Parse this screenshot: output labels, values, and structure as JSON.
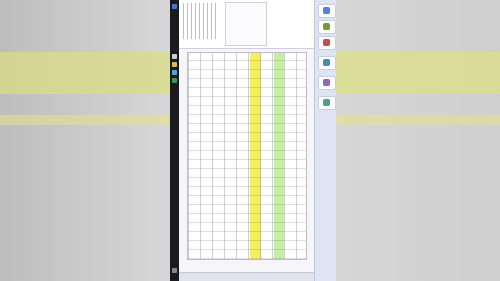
{
  "overlay": {
    "caption": ""
  },
  "colors": {
    "highlight_green": "#c6eea0",
    "highlight_yellow": "#f3f05a",
    "overlay_red": "#e81a1a",
    "ribbon_bg": "#dfe4f2",
    "taskbar": "#1b1b1f"
  },
  "taskbar": {
    "icons": [
      "start-icon",
      "search-icon",
      "folder-icon",
      "browser-icon",
      "app-icon"
    ]
  },
  "ribbon": {
    "buttons": [
      "ribbon-btn-1",
      "ribbon-btn-2",
      "ribbon-btn-3",
      "ribbon-btn-4",
      "ribbon-btn-5",
      "ribbon-btn-6"
    ]
  },
  "sheet": {
    "highlighted_columns": [
      {
        "color": "green"
      },
      {
        "color": "yellow"
      }
    ]
  }
}
